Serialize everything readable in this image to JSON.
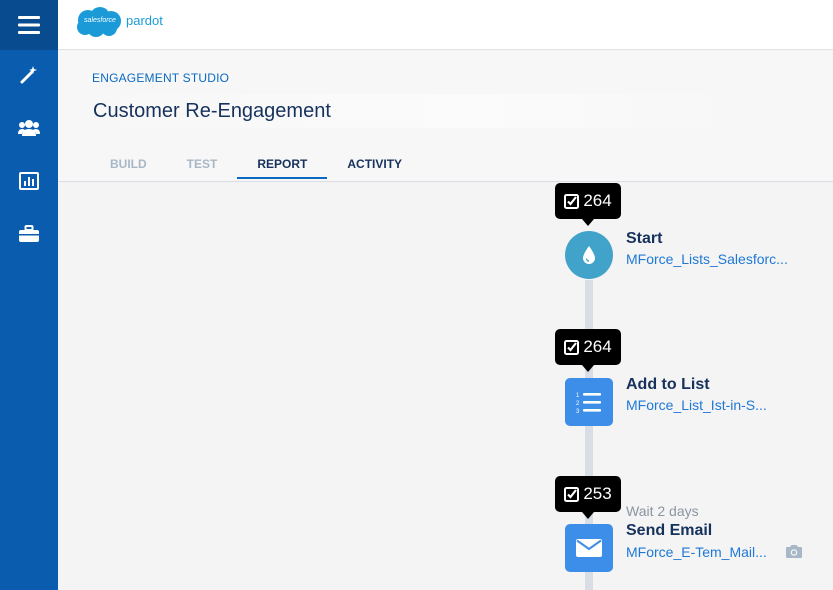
{
  "brand": {
    "logo_text": "salesforce",
    "product": "pardot",
    "cloud_color": "#1a9bd7"
  },
  "rail": {
    "background": "#0a5dae",
    "items": [
      {
        "icon": "menu-icon"
      },
      {
        "icon": "magic-wand-icon"
      },
      {
        "icon": "people-icon"
      },
      {
        "icon": "bar-chart-icon"
      },
      {
        "icon": "briefcase-icon"
      }
    ]
  },
  "header": {
    "eyebrow": "ENGAGEMENT STUDIO",
    "title": "Customer Re-Engagement"
  },
  "tabs": [
    {
      "label": "BUILD",
      "active": false
    },
    {
      "label": "TEST",
      "active": false
    },
    {
      "label": "REPORT",
      "active": true
    },
    {
      "label": "ACTIVITY",
      "active": false
    }
  ],
  "flow": {
    "steps": [
      {
        "count": "264",
        "title": "Start",
        "subtitle": "MForce_Lists_Salesforc...",
        "icon": "drop-icon"
      },
      {
        "count": "264",
        "title": "Add to List",
        "subtitle": "MForce_List_Ist-in-S...",
        "icon": "numbered-list-icon"
      },
      {
        "count": "253",
        "title": "Send Email",
        "subtitle": "MForce_E-Tem_Mail...",
        "wait": "Wait 2 days",
        "icon": "envelope-icon",
        "extra_icon": "camera-icon"
      }
    ]
  }
}
